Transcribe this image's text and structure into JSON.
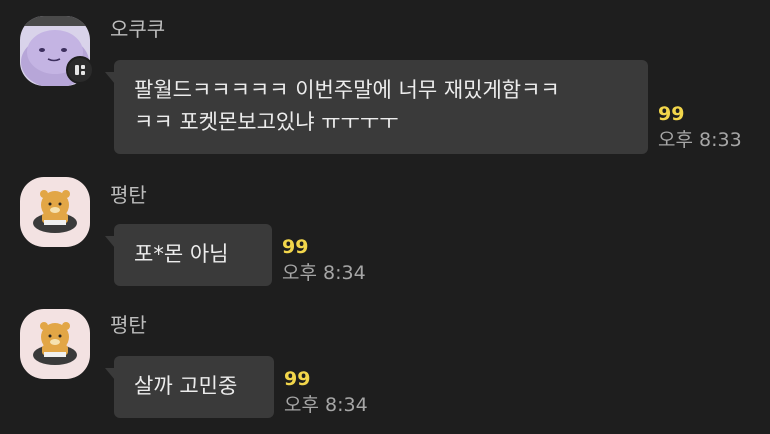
{
  "messages": [
    {
      "sender": "오쿠쿠",
      "text_lines": [
        "팔월드ㅋㅋㅋㅋㅋ 이번주말에 너무 재밌게함ㅋㅋ",
        "ㅋㅋ 포켓몬보고있냐 ㅠㅜㅜㅜ"
      ],
      "unread": "99",
      "time": "오후 8:33",
      "avatar_icon": "purple-blob-avatar-icon"
    },
    {
      "sender": "평탄",
      "text_lines": [
        "포*몬 아님"
      ],
      "unread": "99",
      "time": "오후 8:34",
      "avatar_icon": "bear-avatar-icon"
    },
    {
      "sender": "평탄",
      "text_lines": [
        "살까 고민중"
      ],
      "unread": "99",
      "time": "오후 8:34",
      "avatar_icon": "bear-avatar-icon"
    }
  ],
  "colors": {
    "background": "#1e1e1e",
    "bubble": "#3a3a3a",
    "unread": "#f2d64b",
    "time": "#a6a6a6"
  }
}
